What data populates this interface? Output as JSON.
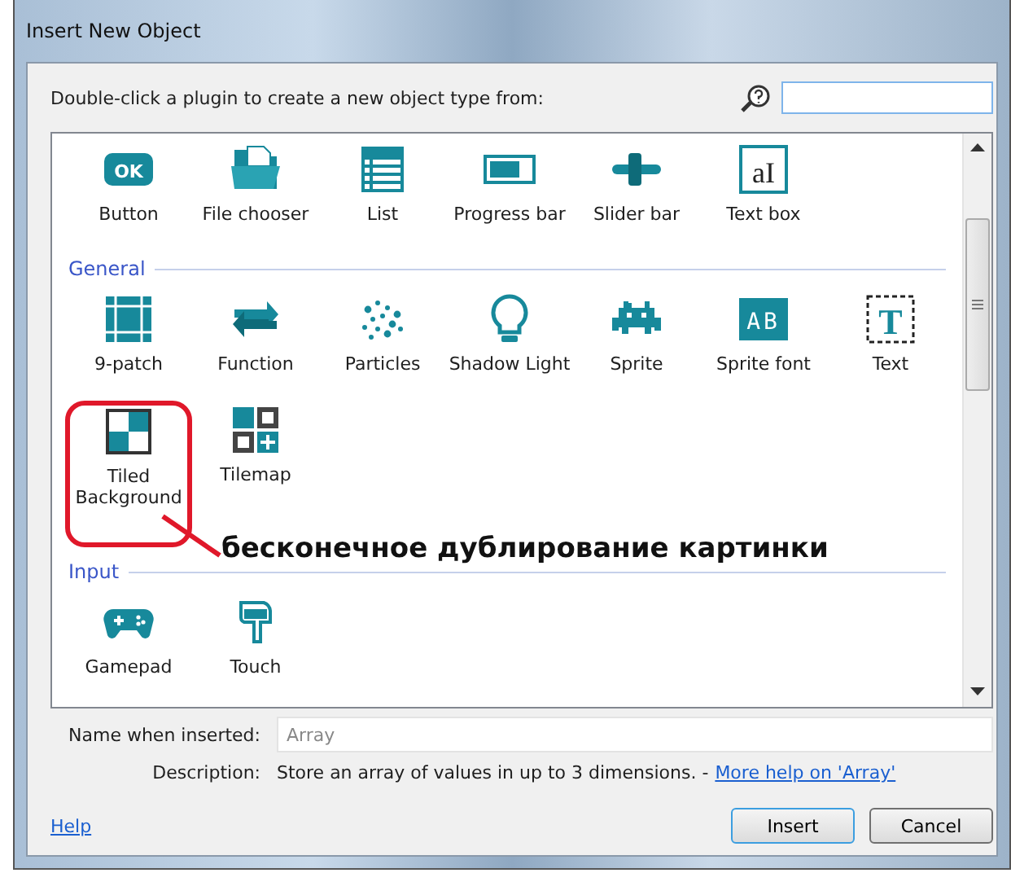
{
  "window": {
    "title": "Insert New Object"
  },
  "prompt": "Double-click a plugin to create a new object type from:",
  "sections": [
    {
      "items": [
        {
          "label": "Button",
          "highlighted": false,
          "icon_text": "OK"
        },
        {
          "label": "File chooser",
          "highlighted": false
        },
        {
          "label": "List",
          "highlighted": false
        },
        {
          "label": "Progress bar",
          "highlighted": false
        },
        {
          "label": "Slider bar",
          "highlighted": false
        },
        {
          "label": "Text box",
          "highlighted": false,
          "icon_text": "aI"
        }
      ]
    },
    {
      "title": "General",
      "items": [
        {
          "label": "9-patch",
          "highlighted": false
        },
        {
          "label": "Function",
          "highlighted": false
        },
        {
          "label": "Particles",
          "highlighted": false
        },
        {
          "label": "Shadow Light",
          "highlighted": false
        },
        {
          "label": "Sprite",
          "highlighted": false
        },
        {
          "label": "Sprite font",
          "highlighted": false,
          "icon_text": "AB"
        },
        {
          "label": "Text",
          "highlighted": false,
          "icon_text": "T"
        },
        {
          "label": "Tiled Background",
          "highlighted": true
        },
        {
          "label": "Tilemap",
          "highlighted": false
        }
      ]
    },
    {
      "title": "Input",
      "items": [
        {
          "label": "Gamepad",
          "highlighted": false
        },
        {
          "label": "Touch",
          "highlighted": false
        }
      ]
    }
  ],
  "annotation": "бесконечное дублирование картинки",
  "name_field": {
    "label": "Name when inserted:",
    "placeholder": "Array"
  },
  "description": {
    "label": "Description:",
    "text": "Store an array of values in up to 3 dimensions. -",
    "link": "More help on 'Array'"
  },
  "help_link": "Help",
  "buttons": [
    {
      "label": "Insert",
      "default": true
    },
    {
      "label": "Cancel",
      "default": false
    }
  ]
}
